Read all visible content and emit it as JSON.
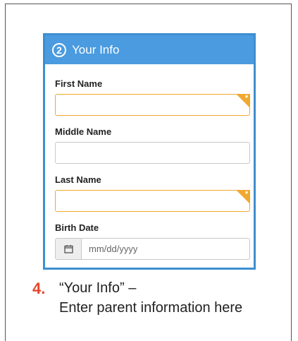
{
  "panel": {
    "step_number": "2",
    "title": "Your Info"
  },
  "fields": {
    "first_name": {
      "label": "First Name",
      "value": "",
      "required": true
    },
    "middle_name": {
      "label": "Middle Name",
      "value": ""
    },
    "last_name": {
      "label": "Last Name",
      "value": "",
      "required": true
    },
    "birth_date": {
      "label": "Birth Date",
      "placeholder": "mm/dd/yyyy"
    }
  },
  "required_marker": "*",
  "caption": {
    "number": "4.",
    "line1": "“Your Info” –",
    "line2": "Enter parent information here"
  },
  "colors": {
    "header": "#4a9be0",
    "required": "#f0a830",
    "caption_number": "#e8452c"
  },
  "icons": {
    "birth_date": "calendar-icon"
  }
}
